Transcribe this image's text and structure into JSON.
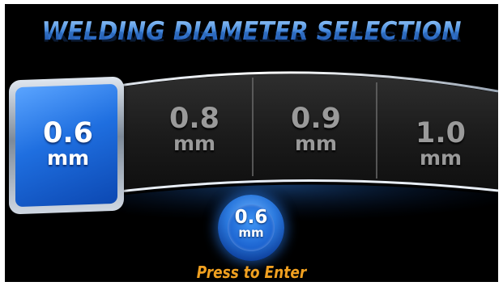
{
  "title": "WELDING DIAMETER SELECTION",
  "selected": {
    "value": "0.6",
    "unit": "mm"
  },
  "options": [
    {
      "value": "0.8",
      "unit": "mm"
    },
    {
      "value": "0.9",
      "unit": "mm"
    },
    {
      "value": "1.0",
      "unit": "mm"
    }
  ],
  "enter": {
    "value": "0.6",
    "unit": "mm",
    "label": "Press to Enter"
  },
  "colors": {
    "background": "#000000",
    "title": "#3f86d8",
    "selected_tile": "#1f6fe0",
    "unselected_text": "#9a9a9a",
    "enter_label": "#f0a020"
  }
}
